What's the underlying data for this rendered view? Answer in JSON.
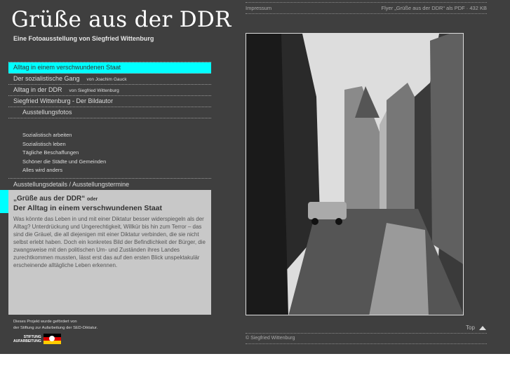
{
  "header": {
    "title": "Grüße aus der DDR",
    "subtitle": "Eine Fotoausstellung von Siegfried Wittenburg"
  },
  "nav": {
    "items": [
      {
        "label": "Alltag in einem verschwundenen Staat",
        "active": true
      },
      {
        "label": "Der sozialistische Gang",
        "byline": "von Joachim Gauck"
      },
      {
        "label": "Alltag in der DDR",
        "byline": "von Siegfried Wittenburg"
      },
      {
        "label": "Siegfried Wittenburg - Der Bildautor"
      },
      {
        "label": "Ausstellungsfotos"
      }
    ],
    "subitems": [
      "Sozialistisch arbeiten",
      "Sozialistisch leben",
      "Tägliche Beschaffungen",
      "Schöner die Städte und Gemeinden",
      "Alles wird anders"
    ],
    "last": "Ausstellungsdetails / Ausstellungstermine"
  },
  "intro": {
    "quote": "„Grüße aus der DDR“",
    "oder": "oder",
    "heading": "Der Alltag in einem verschwundenen Staat",
    "body": "Was könnte das Leben in und mit einer Diktatur besser widerspiegeln als der Alltag? Unterdrückung und Ungerechtigkeit, Willkür bis hin zum Terror – das sind die Gräuel, die all diejenigen mit einer Diktatur verbinden, die sie nicht selbst erlebt haben. Doch ein konkretes Bild der Befindlichkeit der Bürger, die zwangsweise mit den politischen Um- und Zuständen ihres Landes zurechtkommen mussten, lässt erst das auf den ersten Blick unspektakulär erscheinende alltägliche Leben erkennen."
  },
  "funding": {
    "line1": "Dieses Projekt wurde gefördert von",
    "line2": "der Stiftung zur Aufarbeitung der SED-Diktatur.",
    "logo1": "STIFTUNG",
    "logo2": "AUFARBEITUNG"
  },
  "topbar": {
    "impressum": "Impressum",
    "flyer": "Flyer „Grüße aus der DDR“ als PDF · 432 KB"
  },
  "footer": {
    "top": "Top",
    "copyright": "© Siegfried Wittenburg"
  },
  "colors": {
    "accent": "#00ffff",
    "background": "#3f3f3f",
    "box": "#c8c8c8"
  }
}
